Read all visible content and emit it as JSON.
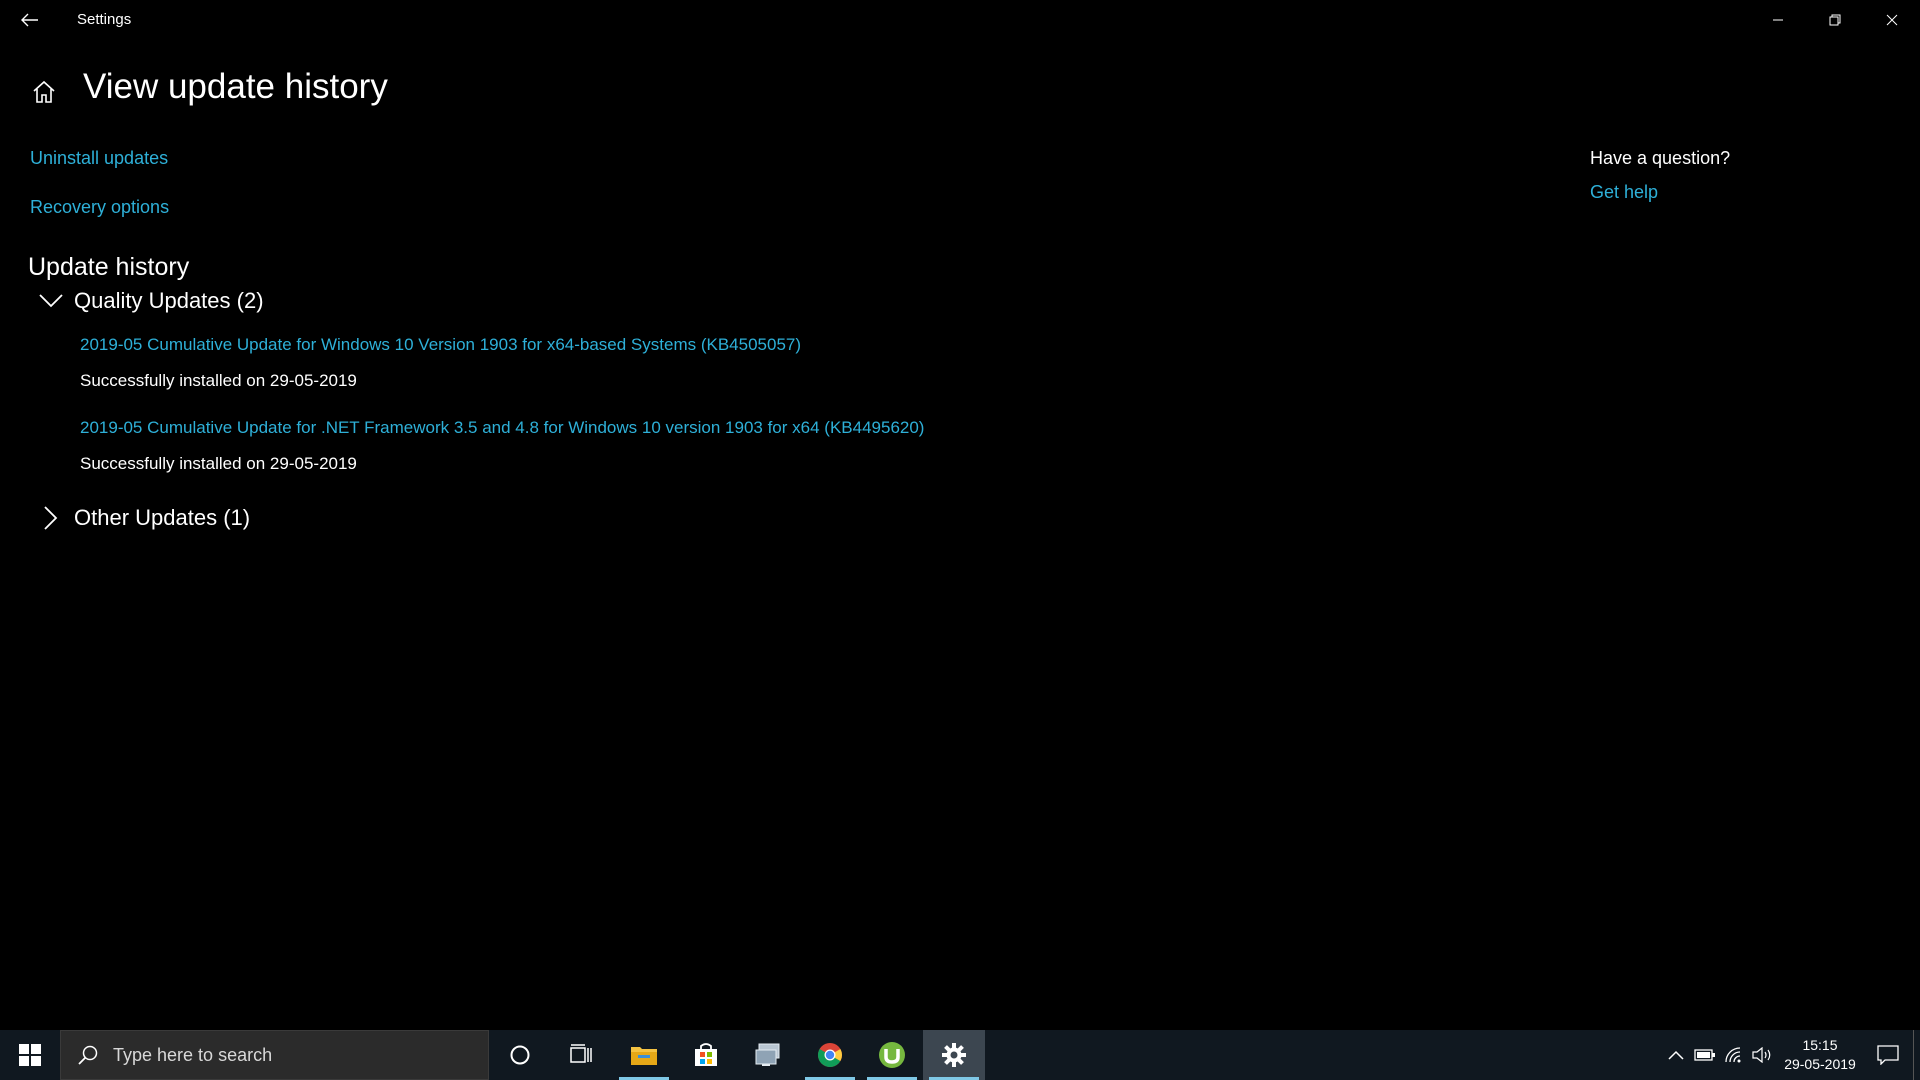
{
  "window": {
    "title": "Settings"
  },
  "page": {
    "title": "View update history",
    "links": {
      "uninstall": "Uninstall updates",
      "recovery": "Recovery options"
    },
    "history": {
      "title": "Update history",
      "groups": [
        {
          "label": "Quality Updates (2)",
          "expanded": true,
          "items": [
            {
              "name": "2019-05 Cumulative Update for Windows 10 Version 1903 for x64-based Systems (KB4505057)",
              "status": "Successfully installed on 29-05-2019"
            },
            {
              "name": "2019-05 Cumulative Update for .NET Framework 3.5 and 4.8 for Windows 10 version 1903 for x64 (KB4495620)",
              "status": "Successfully installed on 29-05-2019"
            }
          ]
        },
        {
          "label": "Other Updates (1)",
          "expanded": false,
          "items": []
        }
      ]
    }
  },
  "help": {
    "question": "Have a question?",
    "link": "Get help"
  },
  "taskbar": {
    "search_placeholder": "Type here to search",
    "clock_time": "15:15",
    "clock_date": "29-05-2019",
    "apps": [
      "cortana-icon",
      "task-view-icon",
      "file-explorer-icon",
      "store-icon",
      "remote-desktop-icon",
      "chrome-icon",
      "utorrent-icon",
      "settings-icon"
    ]
  },
  "colors": {
    "accent_link": "#2eb0d8",
    "background": "#000000",
    "taskbar": "#101820"
  }
}
